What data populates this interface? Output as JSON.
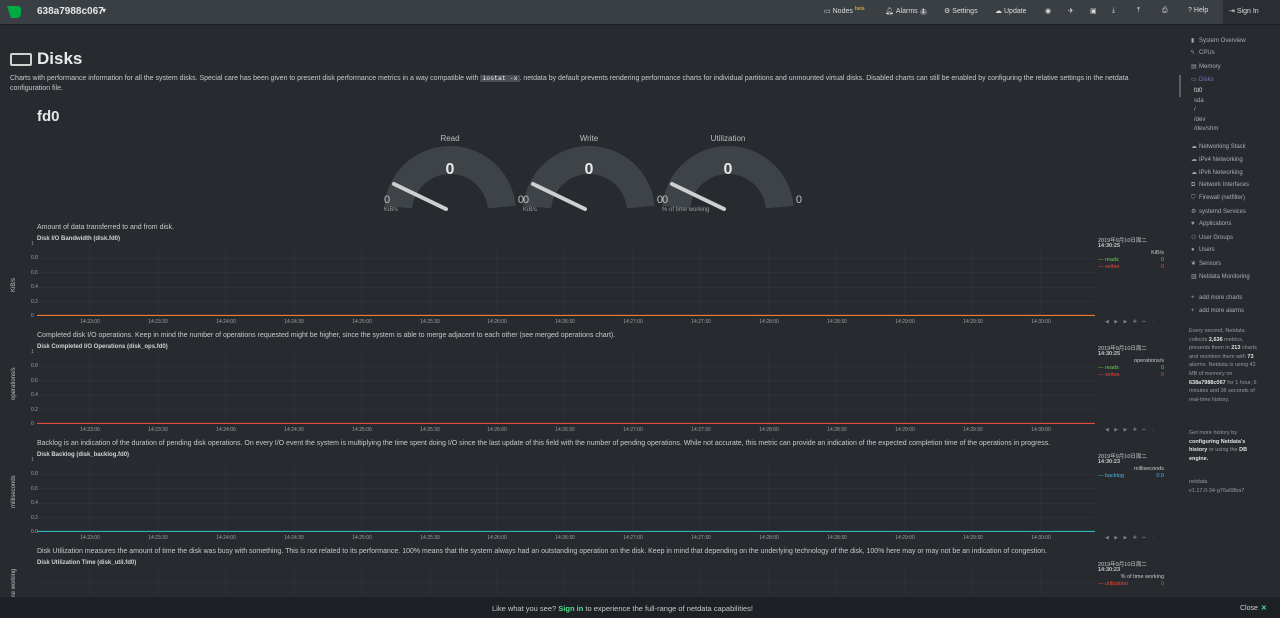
{
  "topbar": {
    "hostname": "638a7988c067",
    "nodes": "Nodes",
    "nodes_beta": "beta",
    "alarms": "Alarms",
    "alarms_count": "1",
    "settings": "Settings",
    "update": "Update",
    "help": "Help",
    "sign_in": "Sign In"
  },
  "page": {
    "title": "Disks",
    "intro_1": "Charts with performance information for all the system disks. Special care has been given to present disk performance metrics in a way compatible with",
    "intro_code": "iostat -x",
    "intro_2": ". netdata by default prevents rendering performance charts for individual partitions and unmounted virtual disks. Disabled charts can still be enabled by configuring the relative settings in the netdata",
    "intro_3": "configuration file.",
    "device": "fd0"
  },
  "gauges": [
    {
      "title": "Read",
      "value": "0",
      "min": "0",
      "max": "0",
      "unit": "KiB/s"
    },
    {
      "title": "Write",
      "value": "0",
      "min": "0",
      "max": "0",
      "unit": "KiB/s"
    },
    {
      "title": "Utilization",
      "value": "0",
      "min": "0",
      "max": "0",
      "unit": "% of time working"
    }
  ],
  "charts": [
    {
      "desc": "Amount of data transferred to and from disk.",
      "title": "Disk I/O Bandwidth (disk.fd0)",
      "ylabel": "KiB/s",
      "yticks": [
        "1",
        "0.8",
        "0.6",
        "0.4",
        "0.2",
        "0"
      ],
      "date": "2019年9月10日周二",
      "time": "14:30:25",
      "unit": "KiB/s",
      "dims": [
        {
          "name": "reads",
          "value": "0",
          "color": "#6acd4a"
        },
        {
          "name": "writes",
          "value": "0",
          "color": "#f44336"
        }
      ],
      "line_color": "#f07a30"
    },
    {
      "desc": "Completed disk I/O operations. Keep in mind the number of operations requested might be higher, since the system is able to merge adjacent to each other (see merged operations chart).",
      "title": "Disk Completed I/O Operations (disk_ops.fd0)",
      "ylabel": "operations/s",
      "yticks": [
        "1",
        "0.8",
        "0.6",
        "0.4",
        "0.2",
        "0"
      ],
      "date": "2019年9月10日周二",
      "time": "14:30:25",
      "unit": "operations/s",
      "dims": [
        {
          "name": "reads",
          "value": "0",
          "color": "#6acd4a"
        },
        {
          "name": "writes",
          "value": "0",
          "color": "#f44336"
        }
      ],
      "line_color": "#e34b3b"
    },
    {
      "desc": "Backlog is an indication of the duration of pending disk operations. On every I/O event the system is multiplying the time spent doing I/O since the last update of this field with the number of pending operations. While not accurate, this metric can provide an indication of the expected completion time of the operations in progress.",
      "title": "Disk Backlog (disk_backlog.fd0)",
      "ylabel": "milliseconds",
      "yticks": [
        "1",
        "0.8",
        "0.6",
        "0.4",
        "0.2",
        "0.0"
      ],
      "date": "2019年9月10日周二",
      "time": "14:30:23",
      "unit": "milliseconds",
      "dims": [
        {
          "name": "backlog",
          "value": "0.0",
          "color": "#4fb3e8"
        }
      ],
      "line_color": "#2ab5b5"
    },
    {
      "desc": "Disk Utilization measures the amount of time the disk was busy with something. This is not related to its performance. 100% means that the system always had an outstanding operation on the disk. Keep in mind that depending on the underlying technology of the disk, 100% here may or may not be an indication of congestion.",
      "title": "Disk Utilization Time (disk_util.fd0)",
      "ylabel": "% of time working",
      "yticks": [],
      "date": "2019年9月10日周二",
      "time": "14:30:23",
      "unit": "% of time working",
      "dims": [
        {
          "name": "utilization",
          "value": "0",
          "color": "#f44336"
        }
      ],
      "line_color": "#e34b3b"
    }
  ],
  "xticks": [
    "14:23:00",
    "14:23:30",
    "14:24:00",
    "14:24:30",
    "14:25:00",
    "14:25:30",
    "14:26:00",
    "14:26:30",
    "14:27:00",
    "14:27:30",
    "14:28:00",
    "14:28:30",
    "14:29:00",
    "14:29:30",
    "14:30:00"
  ],
  "sidebar": {
    "items": [
      {
        "label": "System Overview",
        "icon": "bookmark-icon"
      },
      {
        "label": "CPUs",
        "icon": "bolt-icon"
      },
      {
        "label": "Memory",
        "icon": "memory-icon"
      },
      {
        "label": "Disks",
        "icon": "disk-icon"
      }
    ],
    "subitems": [
      "fd0",
      "sda",
      "/",
      "/dev",
      "/dev/shm"
    ],
    "items2": [
      {
        "label": "Networking Stack",
        "icon": "cloud-icon"
      },
      {
        "label": "IPv4 Networking",
        "icon": "cloud-icon"
      },
      {
        "label": "IPv6 Networking",
        "icon": "cloud-icon"
      },
      {
        "label": "Network Interfaces",
        "icon": "sitemap-icon"
      },
      {
        "label": "Firewall (netfilter)",
        "icon": "shield-icon"
      },
      {
        "label": "systemd Services",
        "icon": "cogs-icon"
      },
      {
        "label": "Applications",
        "icon": "heartbeat-icon"
      },
      {
        "label": "User Groups",
        "icon": "users-icon"
      },
      {
        "label": "Users",
        "icon": "user-icon"
      },
      {
        "label": "Sensors",
        "icon": "leaf-icon"
      },
      {
        "label": "Netdata Monitoring",
        "icon": "bar-chart-icon"
      }
    ],
    "add_charts": "add more charts",
    "add_alarms": "add more alarms",
    "info_1": "Every second, Netdata collects",
    "metrics": "2,636",
    "info_2": "metrics, presents them in",
    "charts_count": "213",
    "info_3": "charts and monitors them with",
    "alarms_count": "73",
    "info_4": "alarms. Netdata is using 42 MB of memory on",
    "host": "638a7988c067",
    "info_5": "for 1 hour, 6 minutes and 36 seconds of real-time history.",
    "history_1": "Get more history by",
    "history_link": "configuring Netdata's history",
    "history_2": "or using the",
    "history_link2": "DB engine.",
    "ver_name": "netdata",
    "version": "v1.17.0-34-g76a08ba7"
  },
  "footer": {
    "msg_1": "Like what you see?",
    "msg_link": "Sign in",
    "msg_2": "to experience the full-range of netdata capabilities!",
    "close": "Close"
  }
}
